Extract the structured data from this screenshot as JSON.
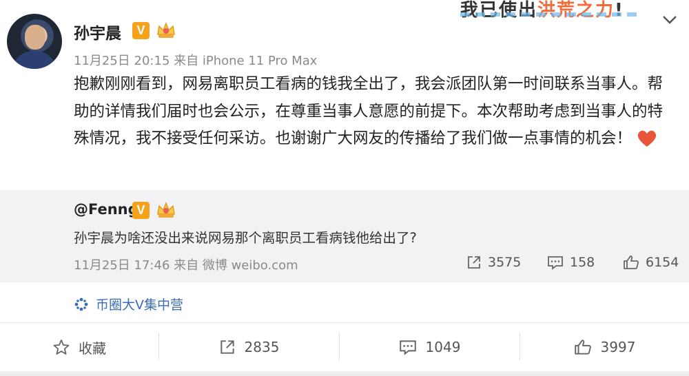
{
  "top_badge": {
    "text_a": "我已使出",
    "text_b": "洪荒之力",
    "text_c": "!"
  },
  "author": {
    "name": "孙宇晨",
    "verified_label": "V"
  },
  "post": {
    "time": "11月25日 20:15",
    "source": "来自 iPhone 11 Pro Max",
    "text": "抱歉刚刚看到，网易离职员工看病的钱我全出了，我会派团队第一时间联系当事人。帮助的详情我们届时也会公示，在尊重当事人意愿的前提下。本次帮助考虑到当事人的特殊情况，我不接受任何采访。也谢谢广大网友的传播给了我们做一点事情的机会！"
  },
  "repost": {
    "user": "@Fenng",
    "verified_label": "V",
    "text": "孙宇晨为啥还没出来说网易那个离职员工看病钱他给出了?",
    "time": "11月25日 17:46",
    "source": "来自 微博 weibo.com",
    "shares": "3575",
    "comments": "158",
    "likes": "6154"
  },
  "topic": {
    "label": "币圈大V集中营"
  },
  "actions": {
    "favorite": "收藏",
    "share": "2835",
    "comment": "1049",
    "like": "3997"
  },
  "colors": {
    "accent_link": "#3a6bb5",
    "verified": "#f5a11a",
    "heart": "#e8553a"
  }
}
